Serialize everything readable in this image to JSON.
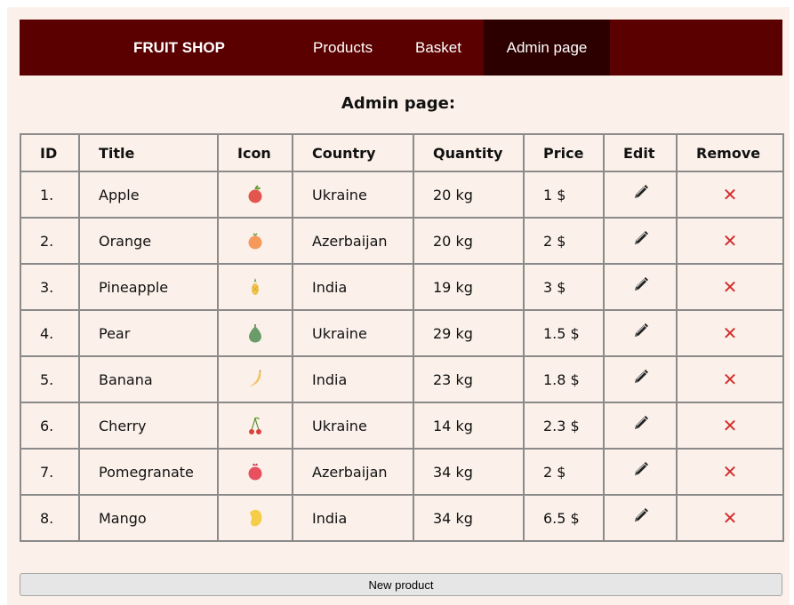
{
  "nav": {
    "brand": "FRUIT SHOP",
    "items": [
      {
        "label": "Products"
      },
      {
        "label": "Basket"
      },
      {
        "label": "Admin page",
        "active": true
      }
    ]
  },
  "page_title": "Admin page:",
  "table": {
    "headers": [
      "ID",
      "Title",
      "Icon",
      "Country",
      "Quantity",
      "Price",
      "Edit",
      "Remove"
    ],
    "rows": [
      {
        "id": "1.",
        "title": "Apple",
        "icon": "apple-icon",
        "country": "Ukraine",
        "quantity": "20 kg",
        "price": "1 $"
      },
      {
        "id": "2.",
        "title": "Orange",
        "icon": "orange-icon",
        "country": "Azerbaijan",
        "quantity": "20 kg",
        "price": "2 $"
      },
      {
        "id": "3.",
        "title": "Pineapple",
        "icon": "pineapple-icon",
        "country": "India",
        "quantity": "19 kg",
        "price": "3 $"
      },
      {
        "id": "4.",
        "title": "Pear",
        "icon": "pear-icon",
        "country": "Ukraine",
        "quantity": "29 kg",
        "price": "1.5 $"
      },
      {
        "id": "5.",
        "title": "Banana",
        "icon": "banana-icon",
        "country": "India",
        "quantity": "23 kg",
        "price": "1.8 $"
      },
      {
        "id": "6.",
        "title": "Cherry",
        "icon": "cherry-icon",
        "country": "Ukraine",
        "quantity": "14 kg",
        "price": "2.3 $"
      },
      {
        "id": "7.",
        "title": "Pomegranate",
        "icon": "pomegranate-icon",
        "country": "Azerbaijan",
        "quantity": "34 kg",
        "price": "2 $"
      },
      {
        "id": "8.",
        "title": "Mango",
        "icon": "mango-icon",
        "country": "India",
        "quantity": "34 kg",
        "price": "6.5 $"
      }
    ],
    "edit_icon": "pencil-icon",
    "remove_icon": "close-icon",
    "remove_glyph": "✕"
  },
  "new_product_label": "New product",
  "colors": {
    "navbar": "#5a0000",
    "navbar_active": "#2d0000",
    "page_background": "#fbf1ea",
    "remove": "#d22d2d"
  }
}
